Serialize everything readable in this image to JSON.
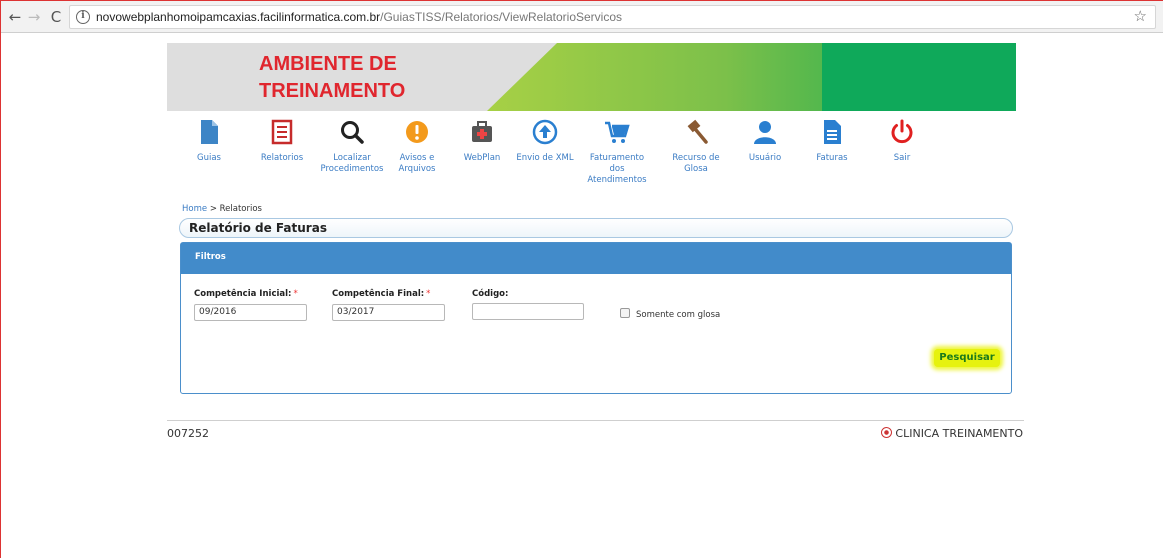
{
  "browser": {
    "url_host": "novowebplanhomoipamcaxias.facilinformatica.com.br",
    "url_path": "/GuiasTISS/Relatorios/ViewRelatorioServicos"
  },
  "banner": {
    "title_line1": "AMBIENTE DE",
    "title_line2": "TREINAMENTO"
  },
  "menu": [
    {
      "label": "Guias",
      "icon": "document-icon"
    },
    {
      "label": "Relatorios",
      "icon": "report-list-icon"
    },
    {
      "label": "Localizar Procedimentos",
      "icon": "search-icon"
    },
    {
      "label": "Avisos e Arquivos",
      "icon": "alert-icon"
    },
    {
      "label": "WebPlan",
      "icon": "medkit-icon"
    },
    {
      "label": "Envio de XML",
      "icon": "upload-icon"
    },
    {
      "label": "Faturamento dos Atendimentos",
      "icon": "cart-icon"
    },
    {
      "label": "Recurso de Glosa",
      "icon": "gavel-icon"
    },
    {
      "label": "Usuário",
      "icon": "user-icon"
    },
    {
      "label": "Faturas",
      "icon": "invoice-icon"
    },
    {
      "label": "Sair",
      "icon": "power-icon"
    }
  ],
  "breadcrumb": {
    "home": "Home",
    "separator": ">",
    "current": "Relatorios"
  },
  "page_title": "Relatório de Faturas",
  "filters": {
    "header": "Filtros",
    "competencia_inicial": {
      "label": "Competência Inicial:",
      "required": "*",
      "value": "09/2016"
    },
    "competencia_final": {
      "label": "Competência Final:",
      "required": "*",
      "value": "03/2017"
    },
    "codigo": {
      "label": "Código:",
      "value": ""
    },
    "somente_glosa": {
      "label": "Somente com glosa",
      "checked": false
    },
    "search_button": "Pesquisar"
  },
  "footer": {
    "code": "007252",
    "clinic": "CLINICA TREINAMENTO"
  },
  "colors": {
    "accent": "#428bca",
    "banner_red": "#e0262e",
    "link": "#3b7cc4"
  }
}
